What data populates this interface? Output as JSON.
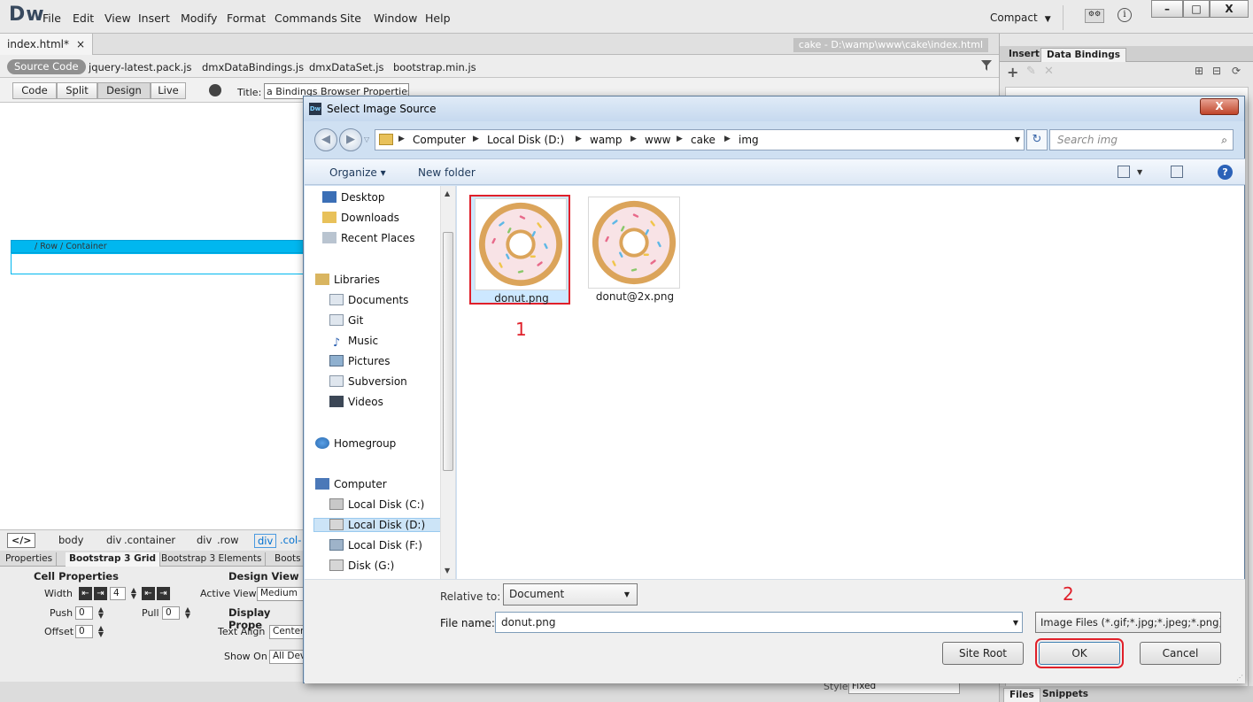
{
  "app": {
    "logo": "Dw",
    "menu": [
      "File",
      "Edit",
      "View",
      "Insert",
      "Modify",
      "Format",
      "Commands",
      "Site",
      "Window",
      "Help"
    ],
    "workspace": "Compact",
    "window_buttons": [
      "–",
      "□",
      "X"
    ]
  },
  "document": {
    "tab": "index.html*",
    "tab_close": "×",
    "path": "cake - D:\\wamp\\www\\cake\\index.html",
    "source_code": "Source Code",
    "related_files": [
      "jquery-latest.pack.js",
      "dmxDataBindings.js",
      "dmxDataSet.js",
      "bootstrap.min.js"
    ],
    "view_buttons": [
      "Code",
      "Split",
      "Design",
      "Live"
    ],
    "title_label": "Title:",
    "title_value": "a Bindings Browser Properties",
    "row_label": "/ Row  / Container"
  },
  "tag_selector": {
    "code": "</>",
    "tags": [
      "body",
      "div",
      ".container",
      "div",
      ".row",
      "div",
      ".col-"
    ]
  },
  "properties": {
    "tabs": [
      "Properties",
      "Bootstrap 3 Grid",
      "Bootstrap 3 Elements",
      "Boots"
    ],
    "cell_properties": "Cell Properties",
    "design_view": "Design View",
    "width_label": "Width",
    "width_value": "4",
    "active_view_label": "Active View",
    "active_view_value": "Medium",
    "push_label": "Push",
    "push_value": "0",
    "pull_label": "Pull",
    "pull_value": "0",
    "display_properties": "Display Prope",
    "offset_label": "Offset",
    "offset_value": "0",
    "text_align_label": "Text Align",
    "text_align_value": "Center",
    "show_on_label": "Show On",
    "show_on_value": "All Dev"
  },
  "right_panel": {
    "tabs": [
      "Insert",
      "Data Bindings"
    ],
    "bottom_tabs": [
      "Files",
      "Snippets"
    ],
    "style_label": "Style",
    "style_value": "Fixed"
  },
  "dialog": {
    "title": "Select Image Source",
    "close": "X",
    "breadcrumb": [
      "Computer",
      "Local Disk (D:)",
      "wamp",
      "www",
      "cake",
      "img"
    ],
    "search_placeholder": "Search img",
    "organize": "Organize ▾",
    "new_folder": "New folder",
    "nav": {
      "favorites": [
        "Desktop",
        "Downloads",
        "Recent Places"
      ],
      "libraries_label": "Libraries",
      "libraries": [
        "Documents",
        "Git",
        "Music",
        "Pictures",
        "Subversion",
        "Videos"
      ],
      "homegroup": "Homegroup",
      "computer_label": "Computer",
      "drives": [
        "Local Disk (C:)",
        "Local Disk (D:)",
        "Local Disk (F:)",
        "Disk (G:)"
      ]
    },
    "files": [
      "donut.png",
      "donut@2x.png"
    ],
    "annotation_1": "1",
    "annotation_2": "2",
    "relative_to_label": "Relative to:",
    "relative_to_value": "Document",
    "file_name_label": "File name:",
    "file_name_value": "donut.png",
    "file_type": "Image Files (*.gif;*.jpg;*.jpeg;*.png)",
    "site_root": "Site Root",
    "ok": "OK",
    "cancel": "Cancel"
  }
}
